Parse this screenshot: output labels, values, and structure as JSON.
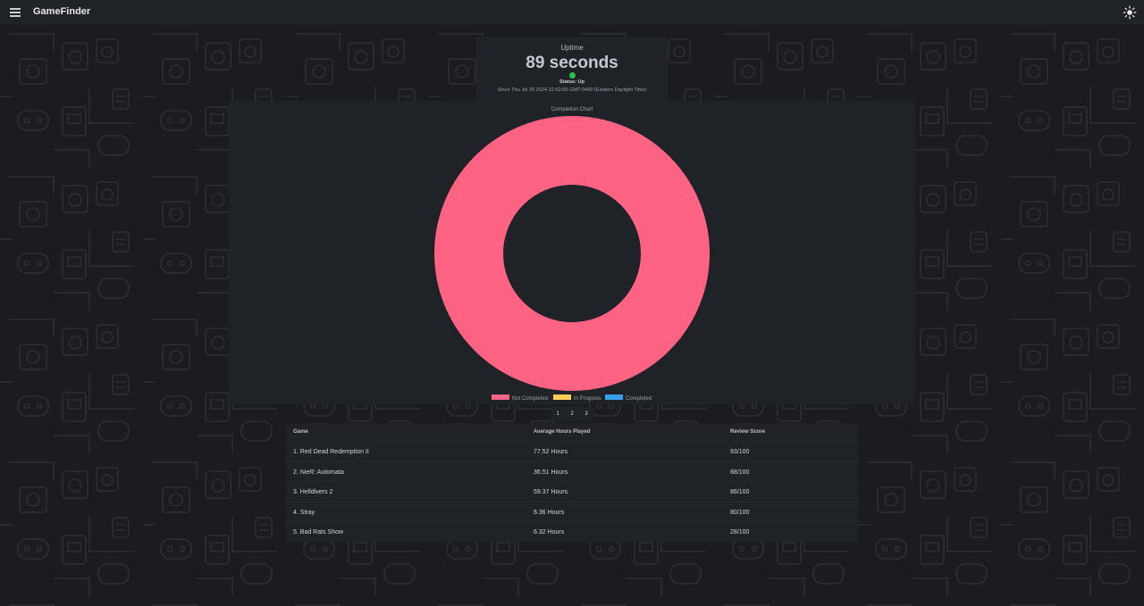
{
  "app": {
    "title": "GameFinder"
  },
  "uptime": {
    "label": "Uptime",
    "value": "89 seconds",
    "status": "Status: Up",
    "since": "Since Thu Jul 25 2024 22:52:05 GMT-0400 (Eastern Daylight Time)",
    "status_color": "#27c24c"
  },
  "chart_data": {
    "type": "pie",
    "title": "Completion Chart",
    "categories": [
      "Not Completed",
      "In Progress",
      "Completed"
    ],
    "values": [
      1,
      0,
      0
    ],
    "colors": [
      "#ff6384",
      "#ffcd56",
      "#36a2eb"
    ],
    "donut": true,
    "legend_position": "bottom"
  },
  "pagination": {
    "pages": [
      "1",
      "2",
      "3"
    ]
  },
  "table": {
    "headers": [
      "Game",
      "Average Hours Played",
      "Review Score"
    ],
    "rows": [
      [
        "1. Red Dead Redemption II",
        "77.52 Hours",
        "93/100"
      ],
      [
        "2. NieR: Automata",
        "36.51 Hours",
        "88/100"
      ],
      [
        "3. Helldivers 2",
        "59.37 Hours",
        "86/100"
      ],
      [
        "4. Stray",
        "6.36 Hours",
        "80/100"
      ],
      [
        "5. Bad Rats Show",
        "6.32 Hours",
        "28/100"
      ]
    ]
  },
  "icons": {
    "menu": "hamburger-menu-icon",
    "theme": "sun-icon"
  },
  "colors": {
    "background": "#1a1c20",
    "card": "#1f2227"
  }
}
